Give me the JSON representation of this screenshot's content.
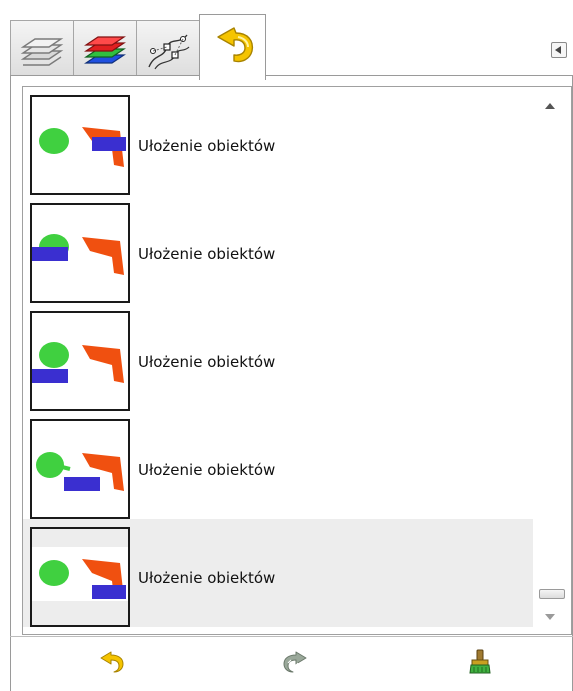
{
  "tabs": [
    {
      "name": "layers",
      "icon": "layers-icon"
    },
    {
      "name": "channels",
      "icon": "channels-icon"
    },
    {
      "name": "paths",
      "icon": "paths-icon"
    },
    {
      "name": "undo-history",
      "icon": "undo-history-icon",
      "active": true
    }
  ],
  "history": {
    "items": [
      {
        "label": "Ułożenie obiektów",
        "selected": false
      },
      {
        "label": "Ułożenie obiektów",
        "selected": false
      },
      {
        "label": "Ułożenie obiektów",
        "selected": false
      },
      {
        "label": "Ułożenie obiektów",
        "selected": false
      },
      {
        "label": "Ułożenie obiektów",
        "selected": true
      }
    ]
  },
  "buttons": [
    {
      "name": "undo-button",
      "icon": "undo-icon"
    },
    {
      "name": "redo-button",
      "icon": "redo-icon"
    },
    {
      "name": "clear-history-button",
      "icon": "broom-icon"
    }
  ],
  "colors": {
    "green_circle": "#40d040",
    "orange_shape": "#f05010",
    "blue_rect": "#3a2fd0",
    "selected_row": "#ededed",
    "undo_arrow": "#f0c000"
  }
}
